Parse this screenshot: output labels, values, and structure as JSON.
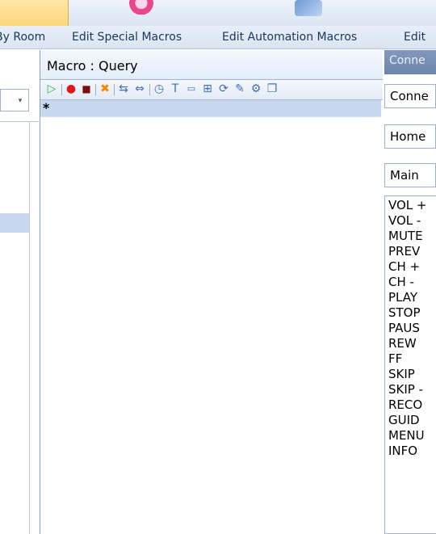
{
  "tabs": {
    "by_room": "By Room",
    "special": "Edit Special Macros",
    "automation": "Edit Automation Macros",
    "edit4": "Edit"
  },
  "macro": {
    "title": "Macro : Query",
    "new_row_marker": "*"
  },
  "right_panel": {
    "title": "Conne",
    "combos": [
      "Conne",
      "Home",
      "Main"
    ],
    "commands": [
      "VOL +",
      "VOL -",
      "MUTE",
      "PREV",
      "CH +",
      "CH -",
      "PLAY",
      "STOP",
      "PAUS",
      "REW",
      "FF",
      "SKIP",
      "SKIP -",
      "RECO",
      "GUID",
      "MENU",
      "INFO"
    ]
  }
}
